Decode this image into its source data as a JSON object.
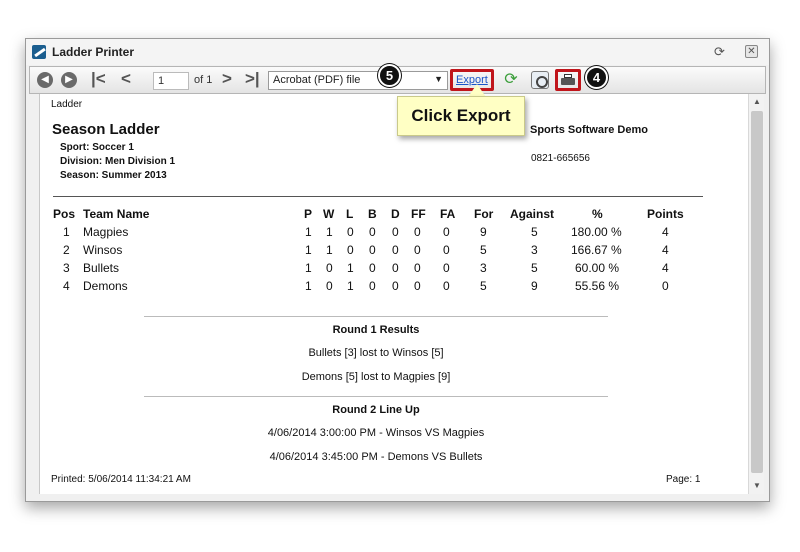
{
  "window": {
    "title": "Ladder Printer"
  },
  "toolbar": {
    "page_value": "1",
    "page_of": "of 1",
    "format_selected": "Acrobat (PDF) file",
    "export_label": "Export"
  },
  "annotations": {
    "badge_export": "5",
    "badge_print": "4",
    "callout_text": "Click Export"
  },
  "report": {
    "label": "Ladder",
    "title": "Season Ladder",
    "sport": "Sport: Soccer 1",
    "division": "Division: Men Division 1",
    "season": "Season: Summer 2013",
    "org": "Sports Software Demo",
    "phone": "0821-665656",
    "columns": [
      "Pos",
      "Team Name",
      "P",
      "W",
      "L",
      "B",
      "D",
      "FF",
      "FA",
      "For",
      "Against",
      "%",
      "Points"
    ],
    "rows": [
      [
        "1",
        "Magpies",
        "1",
        "1",
        "0",
        "0",
        "0",
        "0",
        "0",
        "9",
        "5",
        "180.00 %",
        "4"
      ],
      [
        "2",
        "Winsos",
        "1",
        "1",
        "0",
        "0",
        "0",
        "0",
        "0",
        "5",
        "3",
        "166.67 %",
        "4"
      ],
      [
        "3",
        "Bullets",
        "1",
        "0",
        "1",
        "0",
        "0",
        "0",
        "0",
        "3",
        "5",
        "60.00 %",
        "4"
      ],
      [
        "4",
        "Demons",
        "1",
        "0",
        "1",
        "0",
        "0",
        "0",
        "0",
        "5",
        "9",
        "55.56 %",
        "0"
      ]
    ],
    "results_title": "Round 1 Results",
    "results": [
      "Bullets [3] lost to Winsos [5]",
      "Demons [5] lost to Magpies [9]"
    ],
    "lineup_title": "Round 2 Line Up",
    "lineup": [
      "4/06/2014 3:00:00 PM - Winsos VS Magpies",
      "4/06/2014 3:45:00 PM - Demons VS Bullets"
    ],
    "printed": "Printed: 5/06/2014 11:34:21 AM",
    "page": "Page: 1"
  },
  "icons": [
    "app-icon",
    "refresh-icon",
    "close-icon",
    "nav-back-icon",
    "nav-forward-icon",
    "first-page-icon",
    "prev-page-icon",
    "next-page-icon",
    "last-page-icon",
    "dropdown-arrow-icon",
    "refresh-report-icon",
    "page-setup-icon",
    "printer-icon"
  ],
  "colors": {
    "highlight": "#c0151b",
    "callout": "#ffffc4",
    "link": "#1a55c8"
  }
}
